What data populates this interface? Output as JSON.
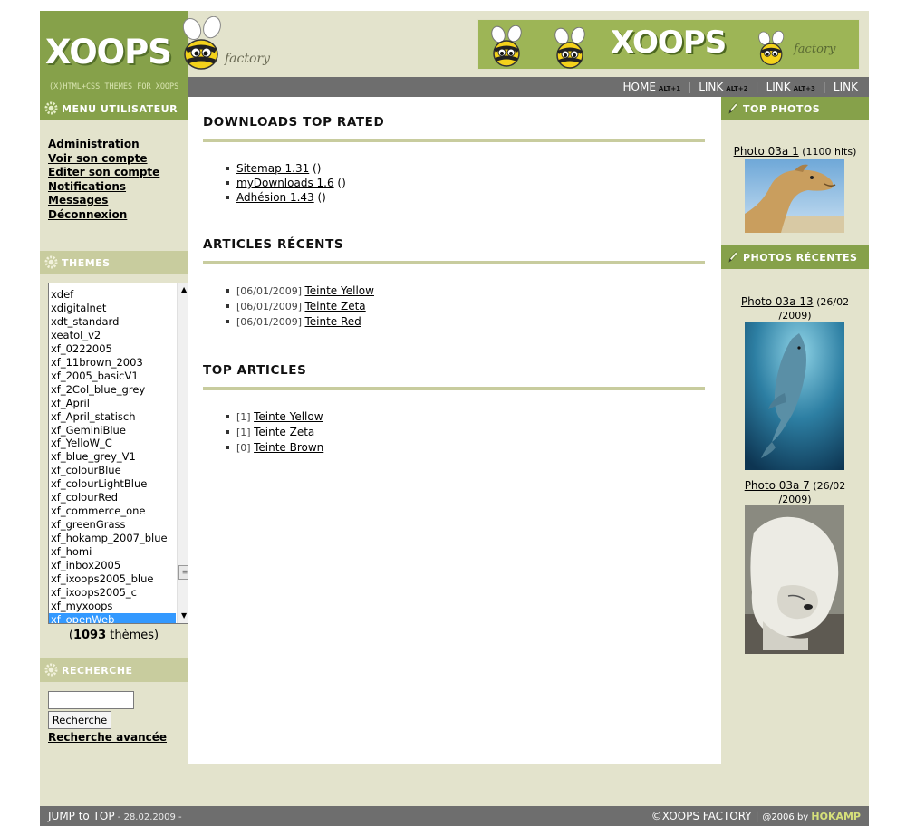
{
  "header": {
    "logo_text": "XOOPS",
    "logo_sub": "factory",
    "tagline": "(X)HTML+CSS THEMES FOR XOOPS",
    "banner_text": "XOOPS",
    "banner_sub": "factory"
  },
  "topnav": {
    "items": [
      {
        "label": "HOME",
        "key": "ALT+1"
      },
      {
        "label": "LINK",
        "key": "ALT+2"
      },
      {
        "label": "LINK",
        "key": "ALT+3"
      },
      {
        "label": "LINK",
        "key": ""
      }
    ],
    "separator": "|"
  },
  "user_menu": {
    "title": "MENU UTILISATEUR",
    "items": [
      "Administration",
      "Voir son compte",
      "Editer son compte",
      "Notifications",
      "Messages",
      "Déconnexion"
    ]
  },
  "themes": {
    "title": "THEMES",
    "options": [
      "xdef",
      "xdigitalnet",
      "xdt_standard",
      "xeatol_v2",
      "xf_0222005",
      "xf_11brown_2003",
      "xf_2005_basicV1",
      "xf_2Col_blue_grey",
      "xf_April",
      "xf_April_statisch",
      "xf_GeminiBlue",
      "xf_YelloW_C",
      "xf_blue_grey_V1",
      "xf_colourBlue",
      "xf_colourLightBlue",
      "xf_colourRed",
      "xf_commerce_one",
      "xf_greenGrass",
      "xf_hokamp_2007_blue",
      "xf_homi",
      "xf_inbox2005",
      "xf_ixoops2005_blue",
      "xf_ixoops2005_c",
      "xf_myxoops",
      "xf_openWeb"
    ],
    "selected": "xf_openWeb",
    "count_open": "(",
    "count": "1093",
    "count_suffix": " thèmes)"
  },
  "search": {
    "title": "RECHERCHE",
    "input_value": "",
    "button_label": "Recherche",
    "advanced_label": "Recherche avancée"
  },
  "main": {
    "downloads": {
      "title": "DOWNLOADS TOP RATED",
      "items": [
        {
          "link": "Sitemap 1.31",
          "suffix": " ()"
        },
        {
          "link": "myDownloads 1.6",
          "suffix": " ()"
        },
        {
          "link": "Adhésion 1.43",
          "suffix": " ()"
        }
      ]
    },
    "recent_articles": {
      "title": "ARTICLES RÉCENTS",
      "items": [
        {
          "meta": "[06/01/2009] ",
          "link": "Teinte Yellow"
        },
        {
          "meta": "[06/01/2009] ",
          "link": "Teinte Zeta"
        },
        {
          "meta": "[06/01/2009] ",
          "link": "Teinte Red"
        }
      ]
    },
    "top_articles": {
      "title": "TOP ARTICLES",
      "items": [
        {
          "meta": "[1] ",
          "link": "Teinte Yellow"
        },
        {
          "meta": "[1] ",
          "link": "Teinte Zeta"
        },
        {
          "meta": "[0] ",
          "link": "Teinte Brown"
        }
      ]
    }
  },
  "right": {
    "top_photos": {
      "title": "TOP PHOTOS",
      "items": [
        {
          "link": "Photo 03a 1",
          "meta": " (1100 hits)",
          "image": "camel"
        }
      ]
    },
    "recent_photos": {
      "title": "PHOTOS RÉCENTES",
      "items": [
        {
          "link": "Photo 03a 13",
          "meta_line1": " (26/02",
          "meta_line2": "/2009)",
          "image": "dolphin"
        },
        {
          "link": "Photo 03a 7",
          "meta_line1": " (26/02",
          "meta_line2": "/2009)",
          "image": "polar-bear"
        }
      ]
    }
  },
  "footer": {
    "jump_label": "JUMP to TOP",
    "date": " - 28.02.2009 -",
    "copyright": "©XOOPS FACTORY",
    "sep": " | ",
    "year_by": "@2006 by ",
    "author": "HOKAMP"
  },
  "colors": {
    "olive_green": "#86a14a",
    "light_olive": "#c8cc9e",
    "page_bg": "#e3e3cc",
    "nav_gray": "#6e6e6e",
    "select_blue": "#3399ff"
  }
}
